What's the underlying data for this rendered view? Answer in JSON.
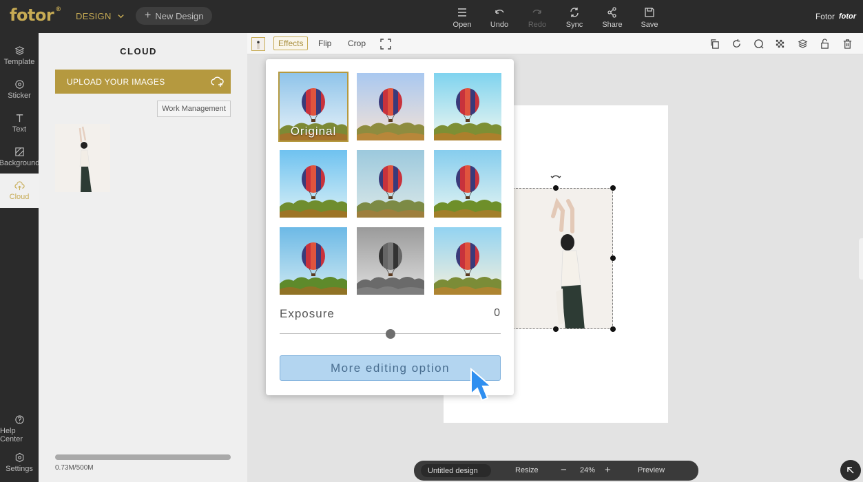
{
  "topbar": {
    "logo": "fotor",
    "logo_mark": "®",
    "design_menu": "DESIGN",
    "new_design": "New Design",
    "tools": [
      {
        "label": "Open",
        "icon": "menu-icon",
        "enabled": true
      },
      {
        "label": "Undo",
        "icon": "undo-icon",
        "enabled": true
      },
      {
        "label": "Redo",
        "icon": "redo-icon",
        "enabled": false
      },
      {
        "label": "Sync",
        "icon": "sync-icon",
        "enabled": true
      },
      {
        "label": "Share",
        "icon": "share-icon",
        "enabled": true
      },
      {
        "label": "Save",
        "icon": "save-icon",
        "enabled": true
      }
    ],
    "brand_text": "Fotor",
    "brand_mini": "fotor"
  },
  "rail": {
    "items": [
      {
        "label": "Template",
        "icon": "layers-icon",
        "active": false
      },
      {
        "label": "Sticker",
        "icon": "sticker-icon",
        "active": false
      },
      {
        "label": "Text",
        "icon": "text-icon",
        "active": false
      },
      {
        "label": "Background",
        "icon": "background-icon",
        "active": false
      },
      {
        "label": "Cloud",
        "icon": "cloud-upload-icon",
        "active": true
      }
    ],
    "bottom_items": [
      {
        "label": "Help Center",
        "icon": "help-icon"
      },
      {
        "label": "Settings",
        "icon": "settings-icon"
      }
    ]
  },
  "panel": {
    "title": "CLOUD",
    "upload_label": "UPLOAD YOUR IMAGES",
    "work_management": "Work Management",
    "storage_used": 0.0015,
    "storage_text": "0.73M/500M"
  },
  "toolbar": {
    "effects": "Effects",
    "flip": "Flip",
    "crop": "Crop"
  },
  "effects_popup": {
    "original_label": "Original",
    "filters": [
      {
        "id": "original",
        "selected": true
      },
      {
        "id": "filter-2",
        "selected": false
      },
      {
        "id": "filter-3",
        "selected": false
      },
      {
        "id": "filter-4",
        "selected": false
      },
      {
        "id": "filter-5",
        "selected": false
      },
      {
        "id": "filter-6",
        "selected": false
      },
      {
        "id": "filter-7",
        "selected": false
      },
      {
        "id": "filter-8",
        "selected": false
      },
      {
        "id": "filter-9",
        "selected": false
      }
    ],
    "exposure_label": "Exposure",
    "exposure_value": "0",
    "exposure_level": 0.5,
    "more_button": "More editing option"
  },
  "bottombar": {
    "design_name": "Untitled design",
    "resize": "Resize",
    "minus": "−",
    "zoom": "24%",
    "plus": "+",
    "preview": "Preview"
  },
  "colors": {
    "accent": "#b5993f",
    "dark": "#2b2b2b",
    "button_blue": "#b3d5f0"
  }
}
